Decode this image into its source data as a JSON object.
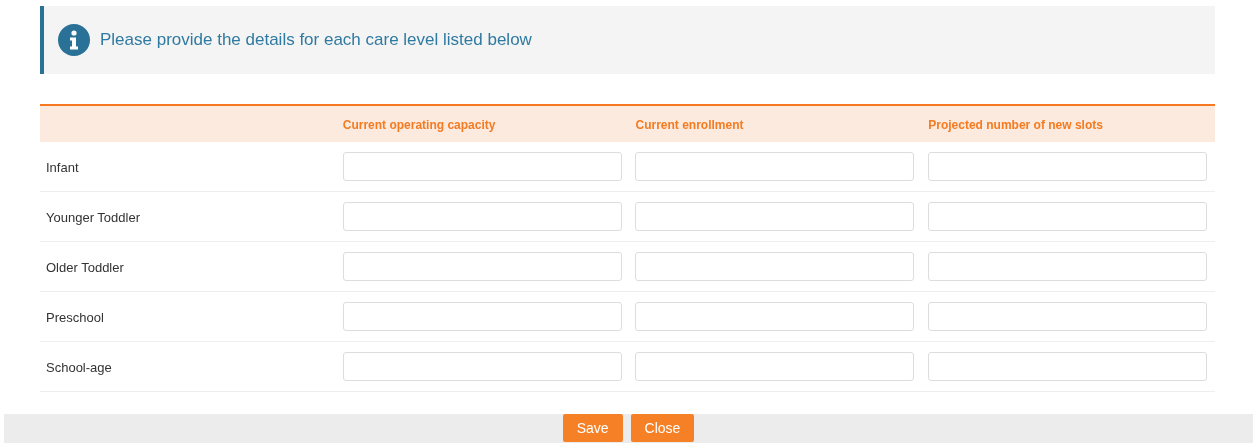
{
  "notice": {
    "text": "Please provide the details for each care level listed below"
  },
  "table": {
    "columns": [
      "Current operating capacity",
      "Current enrollment",
      "Projected number of new slots"
    ],
    "rows": [
      {
        "label": "Infant"
      },
      {
        "label": "Younger Toddler"
      },
      {
        "label": "Older Toddler"
      },
      {
        "label": "Preschool"
      },
      {
        "label": "School-age"
      }
    ]
  },
  "buttons": [
    "Save",
    "Close"
  ]
}
